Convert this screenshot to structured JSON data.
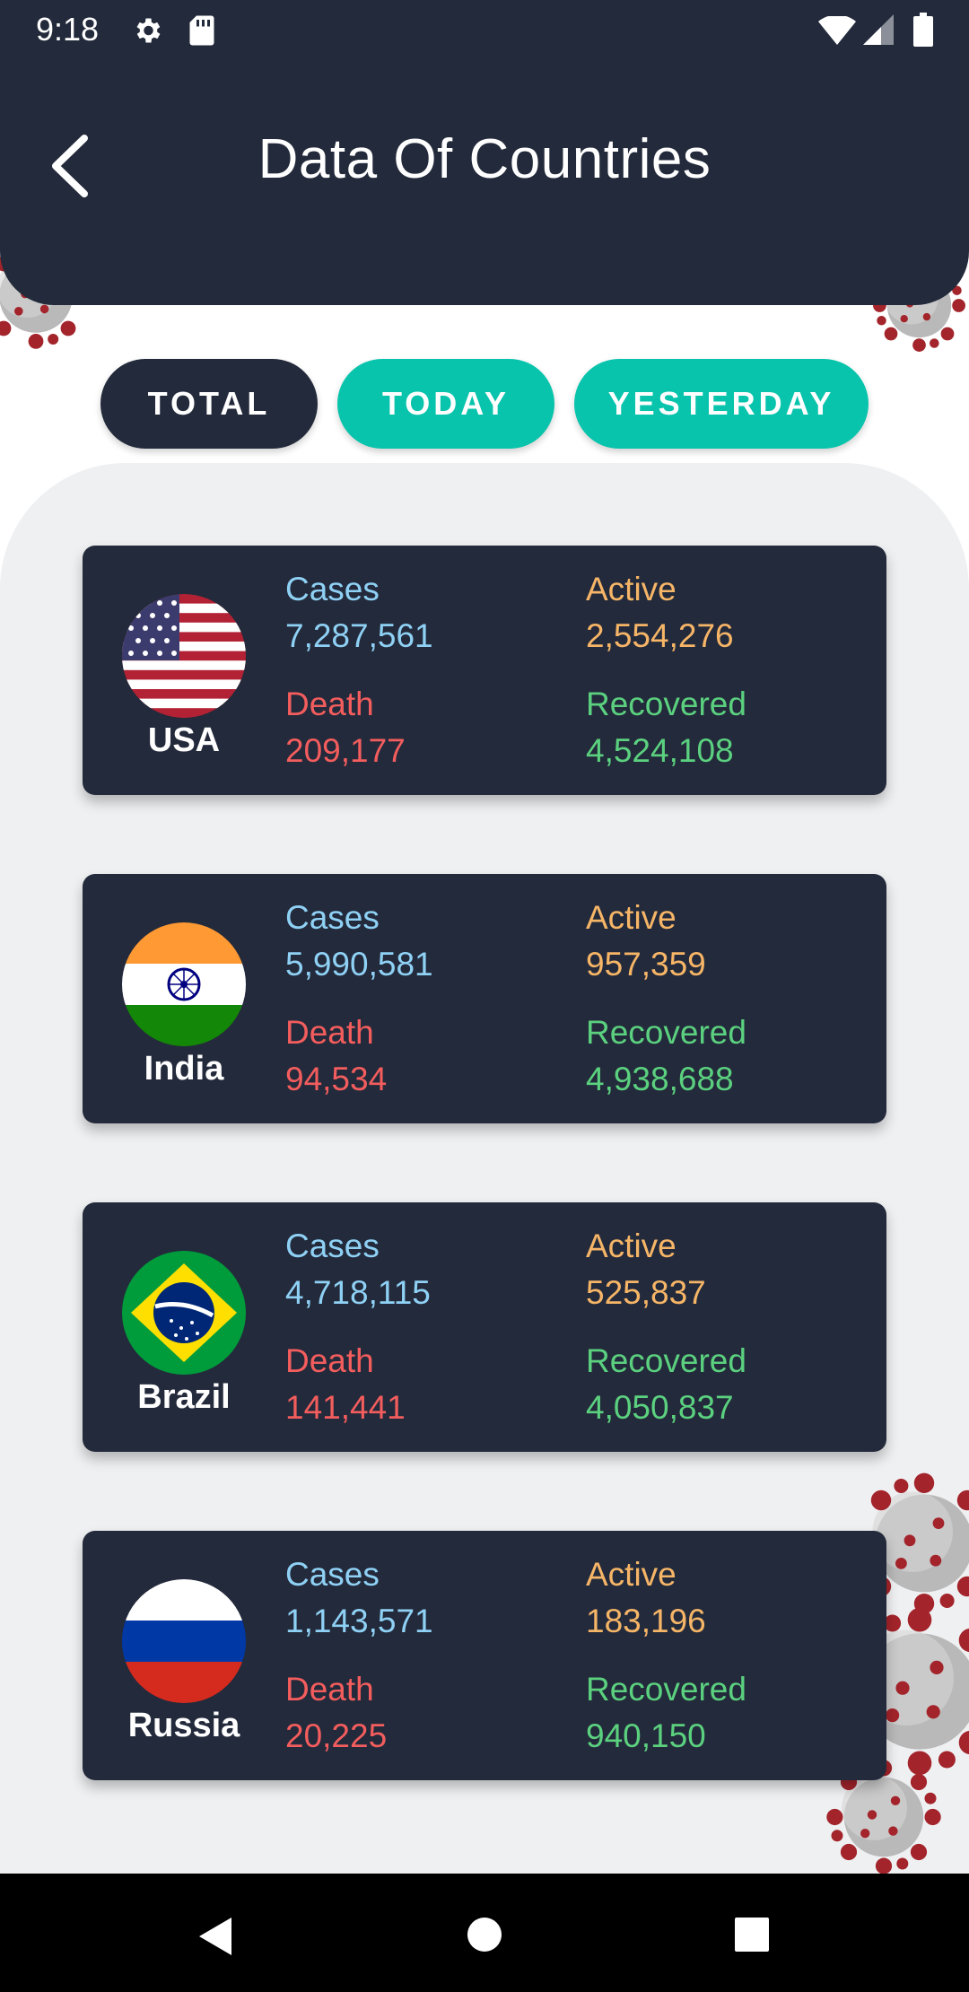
{
  "status_bar": {
    "time": "9:18",
    "icons": [
      "gear-icon",
      "sd-card-icon",
      "wifi-icon",
      "signal-icon",
      "battery-icon"
    ]
  },
  "header": {
    "title": "Data Of Countries",
    "back_icon": "chevron-left-icon"
  },
  "tabs": [
    {
      "label": "TOTAL",
      "selected": true
    },
    {
      "label": "TODAY",
      "selected": false
    },
    {
      "label": "YESTERDAY",
      "selected": false
    }
  ],
  "labels": {
    "cases": "Cases",
    "active": "Active",
    "death": "Death",
    "recovered": "Recovered"
  },
  "countries": [
    {
      "name": "USA",
      "flag": "usa-flag-icon",
      "cases": "7,287,561",
      "active": "2,554,276",
      "death": "209,177",
      "recovered": "4,524,108"
    },
    {
      "name": "India",
      "flag": "india-flag-icon",
      "cases": "5,990,581",
      "active": "957,359",
      "death": "94,534",
      "recovered": "4,938,688"
    },
    {
      "name": "Brazil",
      "flag": "brazil-flag-icon",
      "cases": "4,718,115",
      "active": "525,837",
      "death": "141,441",
      "recovered": "4,050,837"
    },
    {
      "name": "Russia",
      "flag": "russia-flag-icon",
      "cases": "1,143,571",
      "active": "183,196",
      "death": "20,225",
      "recovered": "940,150"
    }
  ],
  "colors": {
    "header_bg": "#232a3b",
    "accent": "#09c4ac",
    "cases": "#8fd1f5",
    "active": "#f6b567",
    "death": "#f35d5d",
    "recovered": "#5bd17f"
  },
  "navigation_bar": [
    "back-icon",
    "home-icon",
    "recents-icon"
  ]
}
